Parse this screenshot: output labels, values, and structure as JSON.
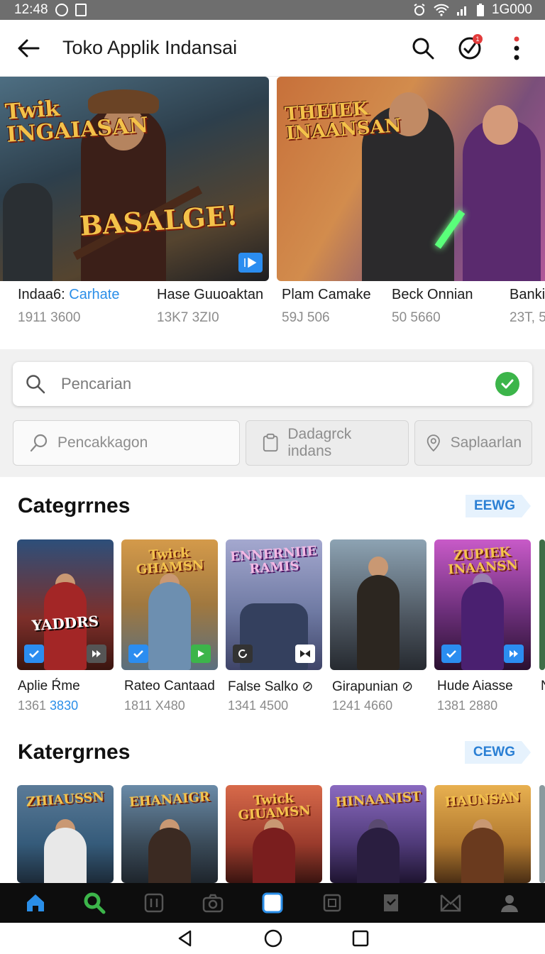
{
  "status_bar": {
    "time": "12:48",
    "right_text": "1G000"
  },
  "app_bar": {
    "title": "Toko Applik Indansai",
    "notification_count": "1"
  },
  "featured": [
    {
      "name_prefix": "Indaa6: ",
      "name_accent": "Carhate",
      "number": "1911 3600",
      "logo": "Twik INGAIASAN",
      "art_text": "BASALGE!"
    },
    {
      "name_prefix": "Hase Guuoaktan",
      "name_accent": "",
      "number": "13K7 3ZI0",
      "logo": "",
      "art_text": ""
    },
    {
      "name_prefix": "Plam Camake",
      "name_accent": "",
      "number": "59J 506",
      "logo": "THEIEK INAANSAN",
      "art_text": ""
    },
    {
      "name_prefix": "Beck Onnian",
      "name_accent": "",
      "number": "50 5660",
      "logo": "",
      "art_text": ""
    },
    {
      "name_prefix": "Banki",
      "name_accent": "",
      "number": "23T, 5",
      "logo": "",
      "art_text": ""
    }
  ],
  "search": {
    "placeholder": "Pencarian",
    "chips": [
      "Pencakkagon",
      "Dadagrck indans",
      "Saplaarlan"
    ]
  },
  "sections": [
    {
      "title": "Categrrnes",
      "see_all": "EEWG",
      "items": [
        {
          "name": "Aplie Ŕme",
          "num_a": "1361 ",
          "num_b": "3830",
          "logo": "YADDRS",
          "badge_l": "check",
          "badge_r": "play",
          "bg": "#7d2f2a"
        },
        {
          "name": "Rateo Cantaad",
          "num_a": "1811 X480",
          "num_b": "",
          "logo": "Twick GHAMSN",
          "badge_l": "check",
          "badge_r": "play-green",
          "bg": "#a0783f"
        },
        {
          "name": "False Salko ⊘",
          "num_a": "1341 4500",
          "num_b": "",
          "logo": "ENNERNIIE RAMIS",
          "badge_l": "loop",
          "badge_r": "bow",
          "bg": "#6f7aa3"
        },
        {
          "name": "Girapunian ⊘",
          "num_a": "1241 4660",
          "num_b": "",
          "logo": "",
          "badge_l": "",
          "badge_r": "",
          "bg": "#4d5660"
        },
        {
          "name": "Hude Aiasse",
          "num_a": "1381 2880",
          "num_b": "",
          "logo": "ZUPIEK INAANSN",
          "badge_l": "check",
          "badge_r": "play",
          "bg": "#6c2f7a"
        },
        {
          "name": "N",
          "num_a": "",
          "num_b": "",
          "logo": "",
          "badge_l": "",
          "badge_r": "",
          "bg": "#3f6f48"
        }
      ]
    },
    {
      "title": "Katergrnes",
      "see_all": "CEWG",
      "items": [
        {
          "name": "",
          "num_a": "",
          "num_b": "",
          "logo": "ZHIAUSSN",
          "bg": "#355b7a"
        },
        {
          "name": "",
          "num_a": "",
          "num_b": "",
          "logo": "EHANAIGR",
          "bg": "#3a4a58"
        },
        {
          "name": "",
          "num_a": "",
          "num_b": "",
          "logo": "Twick GIUAMSN",
          "bg": "#9a3b2c"
        },
        {
          "name": "",
          "num_a": "",
          "num_b": "",
          "logo": "HINAANIST",
          "bg": "#4f3a78"
        },
        {
          "name": "",
          "num_a": "",
          "num_b": "",
          "logo": "HAUNSAN",
          "bg": "#b0782f"
        }
      ]
    }
  ],
  "bottom_nav": [
    "home-icon",
    "search-icon",
    "apps-icon",
    "camera-icon",
    "library-icon",
    "gallery-icon",
    "bookmark-icon",
    "envelope-icon",
    "profile-icon"
  ],
  "colors": {
    "accent": "#2a8ee8",
    "success": "#3cb54a",
    "nav_active_home": "#2a8ee8",
    "nav_active_search": "#3cb54a"
  }
}
